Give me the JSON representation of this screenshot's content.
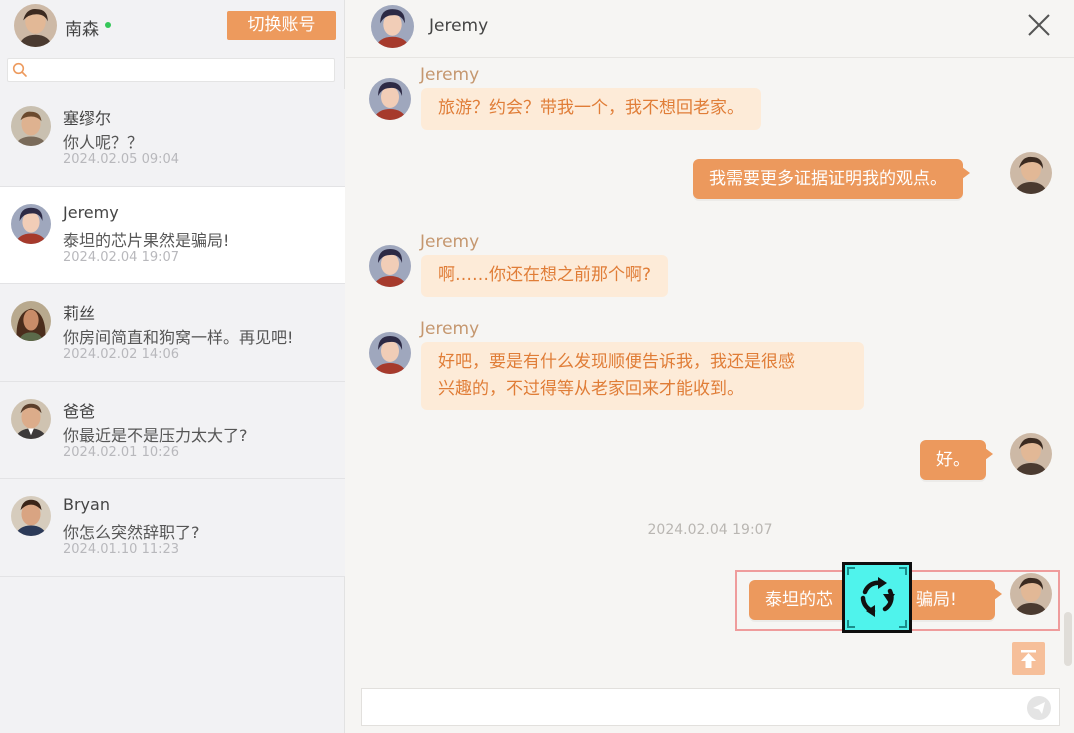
{
  "me": {
    "name": "南森",
    "status": "online",
    "avatar": "portrait-avatar-nanshen"
  },
  "sidebar": {
    "switch_account_label": "切换账号",
    "search": {
      "placeholder": "",
      "value": "",
      "icon": "search-icon"
    },
    "conversations": [
      {
        "name": "塞缪尔",
        "last_message": "你人呢？？",
        "time": "2024.02.05 09:04",
        "avatar": "portrait-avatar-samuel"
      },
      {
        "name": "Jeremy",
        "last_message": "泰坦的芯片果然是骗局!",
        "time": "2024.02.04 19:07",
        "avatar": "portrait-avatar-jeremy",
        "active": true
      },
      {
        "name": "莉丝",
        "last_message": "你房间简直和狗窝一样。再见吧!",
        "time": "2024.02.02 14:06",
        "avatar": "portrait-avatar-lisi"
      },
      {
        "name": "爸爸",
        "last_message": "你最近是不是压力太大了?",
        "time": "2024.02.01 10:26",
        "avatar": "portrait-avatar-dad"
      },
      {
        "name": "Bryan",
        "last_message": "你怎么突然辞职了?",
        "time": "2024.01.10 11:23",
        "avatar": "portrait-avatar-bryan"
      }
    ]
  },
  "chat": {
    "contact_name": "Jeremy",
    "messages": [
      {
        "direction": "in",
        "sender": "Jeremy",
        "lines": [
          "旅游？约会？带我一个，我不想回老家。"
        ]
      },
      {
        "direction": "out",
        "text": "我需要更多证据证明我的观点。"
      },
      {
        "direction": "in",
        "sender": "Jeremy",
        "lines": [
          "啊……你还在想之前那个啊?"
        ]
      },
      {
        "direction": "in",
        "sender": "Jeremy",
        "lines": [
          "好吧，要是有什么发现顺便告诉我，我还是很感",
          "兴趣的，不过得等从老家回来才能收到。"
        ]
      },
      {
        "direction": "out",
        "text": "好。"
      },
      {
        "direction": "out",
        "text": "泰坦的芯片果然是骗局!",
        "visible_left": "泰坦的芯",
        "visible_right": "骗局!",
        "status": "sending"
      }
    ],
    "timestamp": "2024.02.04 19:07",
    "input": {
      "placeholder": "",
      "value": ""
    }
  },
  "colors": {
    "accent": "#ed9a5d",
    "incoming_bubble": "#fdebd8",
    "incoming_text": "#e07d37",
    "retry_overlay": "#4ff3ec"
  },
  "icons": {
    "close": "close-icon",
    "send": "send-icon",
    "to_top": "arrow-up-to-top-icon",
    "retry": "refresh-cycle-icon"
  }
}
